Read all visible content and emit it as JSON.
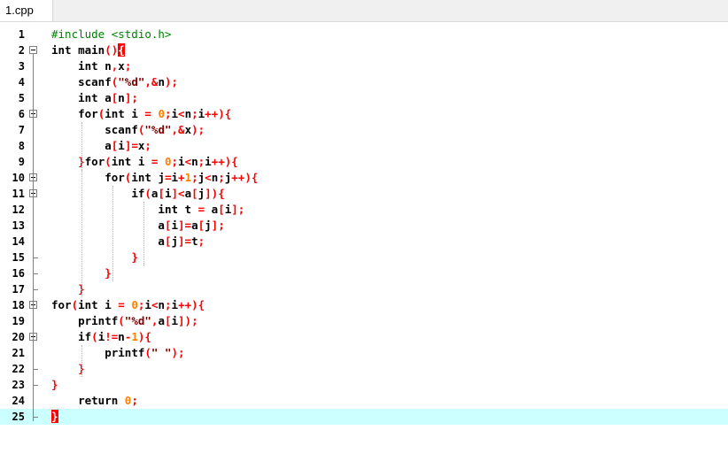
{
  "tab": {
    "label": "1.cpp"
  },
  "lines": [
    {
      "n": "1",
      "text": "#include <stdio.h>"
    },
    {
      "n": "2",
      "text": "int main(){"
    },
    {
      "n": "3",
      "text": "    int n,x;"
    },
    {
      "n": "4",
      "text": "    scanf(\"%d\",&n);"
    },
    {
      "n": "5",
      "text": "    int a[n];"
    },
    {
      "n": "6",
      "text": "    for(int i = 0;i<n;i++){"
    },
    {
      "n": "7",
      "text": "        scanf(\"%d\",&x);"
    },
    {
      "n": "8",
      "text": "        a[i]=x;"
    },
    {
      "n": "9",
      "text": "    }for(int i = 0;i<n;i++){"
    },
    {
      "n": "10",
      "text": "        for(int j=i+1;j<n;j++){"
    },
    {
      "n": "11",
      "text": "            if(a[i]<a[j]){"
    },
    {
      "n": "12",
      "text": "                int t = a[i];"
    },
    {
      "n": "13",
      "text": "                a[i]=a[j];"
    },
    {
      "n": "14",
      "text": "                a[j]=t;"
    },
    {
      "n": "15",
      "text": "            }"
    },
    {
      "n": "16",
      "text": "        }"
    },
    {
      "n": "17",
      "text": "    }"
    },
    {
      "n": "18",
      "text": "for(int i = 0;i<n;i++){"
    },
    {
      "n": "19",
      "text": "    printf(\"%d\",a[i]);"
    },
    {
      "n": "20",
      "text": "    if(i!=n-1){"
    },
    {
      "n": "21",
      "text": "        printf(\" \");"
    },
    {
      "n": "22",
      "text": "    }"
    },
    {
      "n": "23",
      "text": "}"
    },
    {
      "n": "24",
      "text": "    return 0;"
    },
    {
      "n": "25",
      "text": "}"
    }
  ],
  "current_line": "25",
  "colors": {
    "keyword": "#000000",
    "preprocessor": "#008000",
    "operator": "#ff0000",
    "number": "#ff8000",
    "string": "#800000",
    "current_line_bg": "#ccffff",
    "brace_match": "#ff0000"
  },
  "fold_markers": {
    "open": [
      "2",
      "6",
      "10",
      "11",
      "18",
      "20"
    ],
    "close": [
      "15",
      "16",
      "17",
      "22",
      "23",
      "25"
    ]
  }
}
